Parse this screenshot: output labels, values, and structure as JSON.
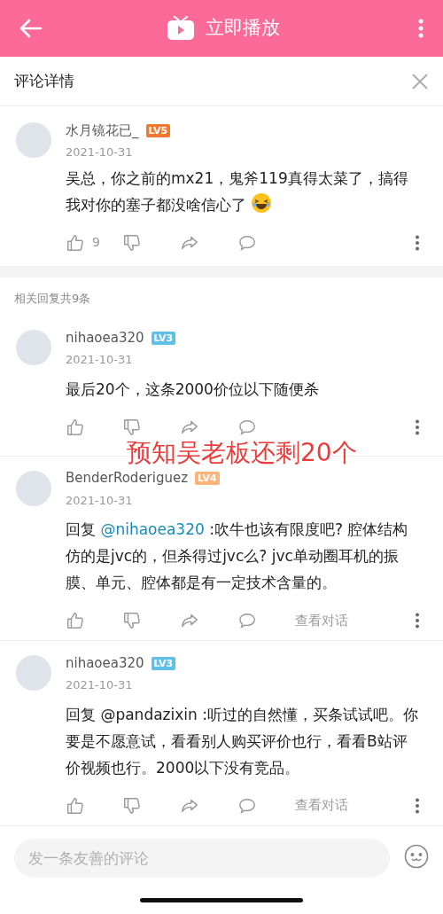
{
  "header": {
    "title": "立即播放"
  },
  "panel": {
    "title": "评论详情"
  },
  "main_comment": {
    "user": "水月镜花已_",
    "level": {
      "label": "LV5",
      "color": "#f0782f"
    },
    "date": "2021-10-31",
    "text": "吴总，你之前的mx21，鬼斧119真得太菜了，搞得我对你的塞子都没啥信心了",
    "emoji": true,
    "likes": "9"
  },
  "replies_heading": "相关回复共9条",
  "replies": [
    {
      "user": "nihaoea320",
      "level": {
        "label": "LV3",
        "color": "#60c1e8"
      },
      "date": "2021-10-31",
      "text": "最后20个，这条2000价位以下随便杀"
    },
    {
      "user": "BenderRoderiguez",
      "level": {
        "label": "LV4",
        "color": "#ffb27a"
      },
      "date": "2021-10-31",
      "reply_prefix": "回复",
      "mention": "@nihaoea320",
      "mention_link": true,
      "text": ":吹牛也该有限度吧? 腔体结构仿的是jvc的，但杀得过jvc么? jvc单动圈耳机的振膜、单元、腔体都是有一定技术含量的。",
      "action": "查看对话"
    },
    {
      "user": "nihaoea320",
      "level": {
        "label": "LV3",
        "color": "#60c1e8"
      },
      "date": "2021-10-31",
      "reply_prefix": "回复",
      "mention": "@pandazixin",
      "mention_link": false,
      "text": ":听过的自然懂，买条试试吧。你要是不愿意试，看看别人购买评价也行，看看B站评价视频也行。2000以下没有竞品。",
      "action": "查看对话"
    }
  ],
  "overlay_text": "预知吴老板还剩20个",
  "comment_box": {
    "placeholder": "发一条友善的评论"
  }
}
